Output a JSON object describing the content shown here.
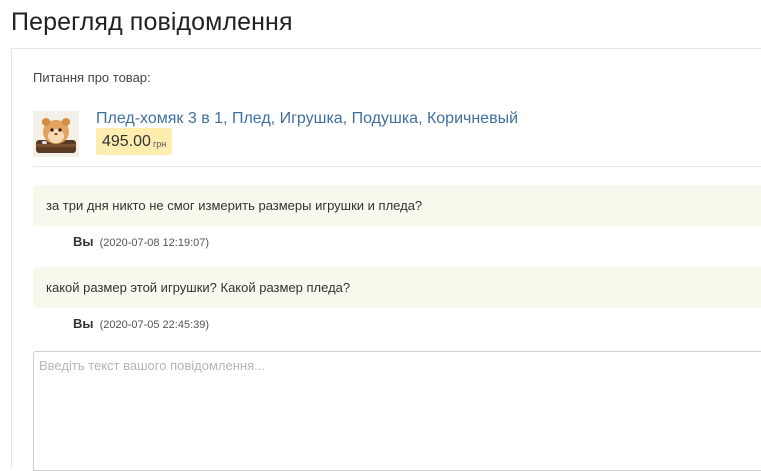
{
  "page": {
    "title": "Перегляд повідомлення"
  },
  "question": {
    "label": "Питання про товар:"
  },
  "product": {
    "name": "Плед-хомяк 3 в 1, Плед, Игрушка, Подушка, Коричневый",
    "price": "495.00",
    "currency": "грн",
    "thumbnail_icon": "hamster-plush-image"
  },
  "messages": [
    {
      "text": "за три дня никто не смог измерить размеры игрушки и пледа?",
      "author": "Вы",
      "timestamp": "(2020-07-08 12:19:07)"
    },
    {
      "text": "какой размер этой игрушки? Какой размер пледа?",
      "author": "Вы",
      "timestamp": "(2020-07-05 22:45:39)"
    }
  ],
  "reply": {
    "placeholder": "Введіть текст вашого повідомлення...",
    "value": ""
  },
  "colors": {
    "link": "#3f6f9f",
    "price_badge": "#fdeeb0",
    "message_bg": "#f8f9ec"
  }
}
